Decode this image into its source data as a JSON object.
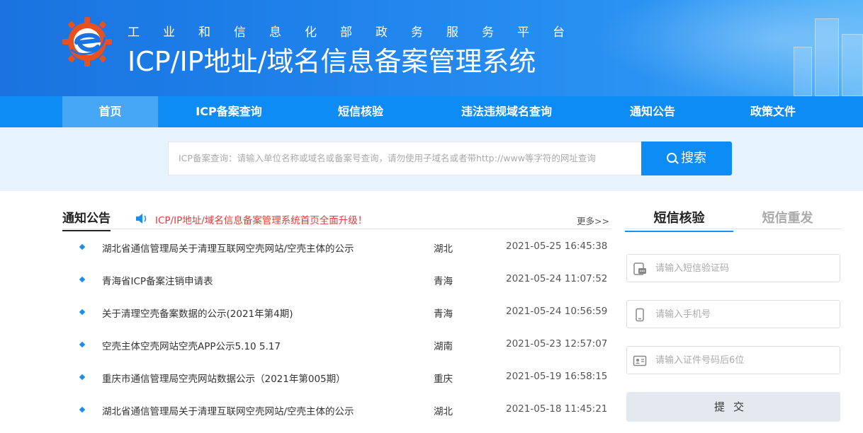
{
  "header": {
    "platform_name": "工业和信息化部政务服务平台",
    "system_title": "ICP/IP地址/域名信息备案管理系统"
  },
  "nav": {
    "items": [
      {
        "label": "首页",
        "active": true
      },
      {
        "label": "ICP备案查询",
        "active": false
      },
      {
        "label": "短信核验",
        "active": false
      },
      {
        "label": "违法违规域名查询",
        "active": false
      },
      {
        "label": "通知公告",
        "active": false
      },
      {
        "label": "政策文件",
        "active": false
      }
    ]
  },
  "search": {
    "placeholder": "ICP备案查询：请输入单位名称或域名或备案号查询，请勿使用子域名或者带http://www等字符的网址查询",
    "button_label": "搜索"
  },
  "notices": {
    "title": "通知公告",
    "upgrade_notice": "ICP/IP地址/域名信息备案管理系统首页全面升级！",
    "more_label": "更多>>",
    "rows": [
      {
        "title": "湖北省通信管理局关于清理互联网空壳网站/空壳主体的公示",
        "region": "湖北",
        "time": "2021-05-25 16:45:38"
      },
      {
        "title": "青海省ICP备案注销申请表",
        "region": "青海",
        "time": "2021-05-24 11:07:52"
      },
      {
        "title": "关于清理空壳备案数据的公示(2021年第4期)",
        "region": "青海",
        "time": "2021-05-24 10:56:59"
      },
      {
        "title": "空壳主体空壳网站空壳APP公示5.10 5.17",
        "region": "湖南",
        "time": "2021-05-23 12:57:07"
      },
      {
        "title": "重庆市通信管理局空壳网站数据公示（2021年第005期）",
        "region": "重庆",
        "time": "2021-05-19 16:58:15"
      },
      {
        "title": "湖北省通信管理局关于清理互联网空壳网站/空壳主体的公示",
        "region": "湖北",
        "time": "2021-05-18 11:45:21"
      }
    ]
  },
  "sms": {
    "tab_verify": "短信核验",
    "tab_resend": "短信重发",
    "code_placeholder": "请输入短信验证码",
    "phone_placeholder": "请输入手机号",
    "id_placeholder": "请输入证件号码后6位",
    "submit_label": "提交"
  },
  "colors": {
    "primary": "#0e8cf5",
    "nav_active": "#47a7f7",
    "search_bg": "#e6f2fd",
    "notice_red": "#e23c3c"
  }
}
